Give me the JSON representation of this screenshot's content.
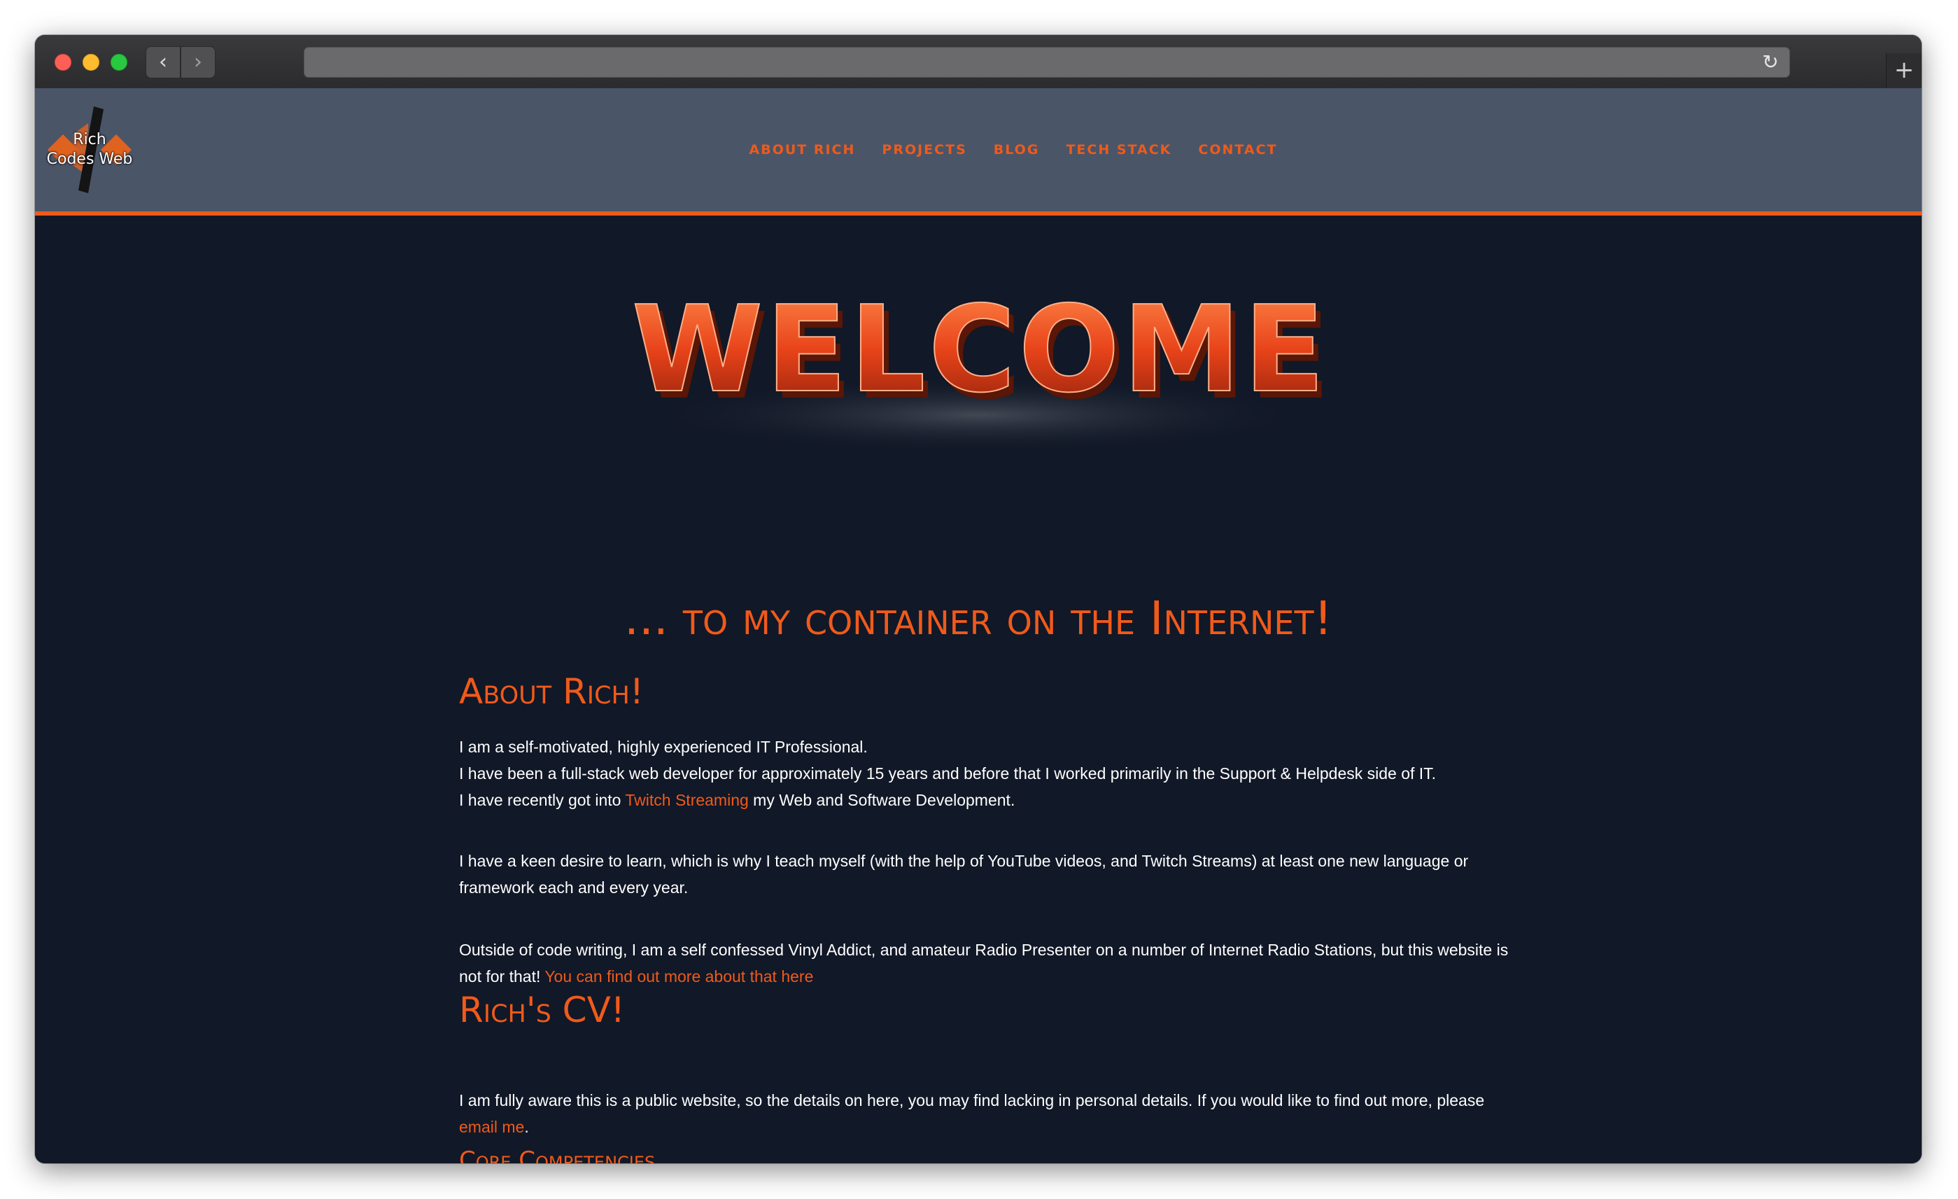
{
  "browser": {
    "back_glyph": "‹",
    "forward_glyph": "›",
    "reload_glyph": "↻",
    "new_tab_glyph": "+"
  },
  "header": {
    "logo": {
      "line1": "Rich",
      "line2": "Codes Web"
    },
    "nav": [
      {
        "label": "ABOUT RICH"
      },
      {
        "label": "PROJECTS"
      },
      {
        "label": "BLOG"
      },
      {
        "label": "TECH STACK"
      },
      {
        "label": "CONTACT"
      }
    ]
  },
  "hero": {
    "welcome_text": "WELCOME",
    "tagline": "... to my container on the Internet!"
  },
  "about": {
    "heading": "About Rich!",
    "p1_line1": "I am a self-motivated, highly experienced IT Professional.",
    "p1_line2": "I have been a full-stack web developer for approximately 15 years and before that I worked primarily in the Support & Helpdesk side of IT.",
    "p1_line3_pre": "I have recently got into ",
    "p1_line3_link": "Twitch Streaming",
    "p1_line3_post": " my Web and Software Development.",
    "p2": "I have a keen desire to learn, which is why I teach myself (with the help of YouTube videos, and Twitch Streams) at least one new language or framework each and every year.",
    "p3_text": "Outside of code writing, I am a self confessed Vinyl Addict, and amateur Radio Presenter on a number of Internet Radio Stations, but this website is not for that! ",
    "p3_link": "You can find out more about that here"
  },
  "cv": {
    "heading": "Rich's CV!",
    "p1_text": "I am fully aware this is a public website, so the details on here, you may find lacking in personal details. If you would like to find out more, please ",
    "p1_link": "email me",
    "p1_end": ".",
    "subheading": "Core Competencies"
  },
  "colors": {
    "accent": "#f05a1a",
    "header_bg": "#4a5568",
    "page_bg": "#111827"
  }
}
